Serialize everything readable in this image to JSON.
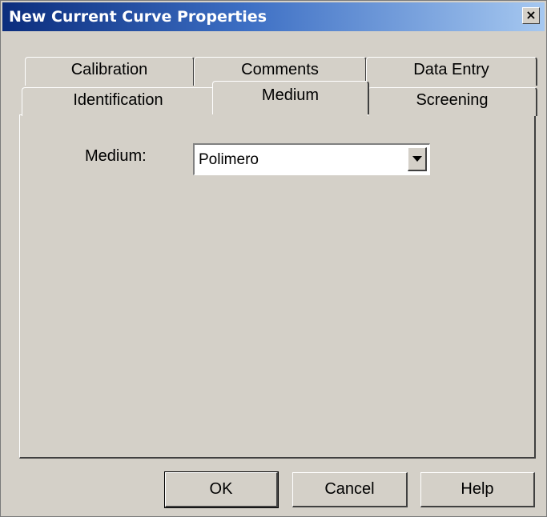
{
  "window": {
    "title": "New Current Curve Properties",
    "close_glyph": "×"
  },
  "tabs": {
    "row_back": [
      {
        "label": "Calibration"
      },
      {
        "label": "Comments"
      },
      {
        "label": "Data Entry"
      }
    ],
    "row_front": [
      {
        "label": "Identification"
      },
      {
        "label": "Medium",
        "active": true
      },
      {
        "label": "Screening"
      }
    ]
  },
  "panel": {
    "medium_label": "Medium:",
    "medium_value": "Polimero"
  },
  "buttons": {
    "ok": "OK",
    "cancel": "Cancel",
    "help": "Help"
  },
  "colors": {
    "dialog_bg": "#d4d0c8",
    "title_start": "#0b2d7d",
    "title_end": "#a6c8f0"
  },
  "icons": {
    "close": "close-icon",
    "dropdown": "chevron-down-icon"
  }
}
